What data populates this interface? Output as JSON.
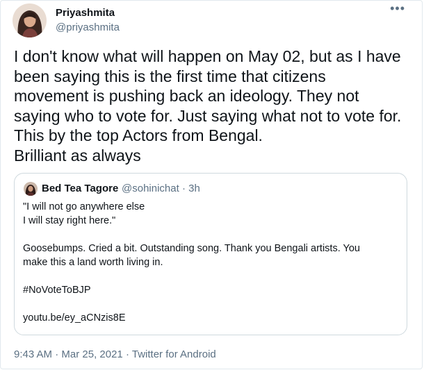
{
  "tweet": {
    "author": {
      "name": "Priyashmita",
      "handle": "@priyashmita",
      "avatar": "user-avatar-photo"
    },
    "more_icon": "more-horizontal-icon",
    "text": "I don't know what will happen on May 02, but as I have\nbeen saying this is the first time that citizens\nmovement is pushing back an ideology. They not\nsaying who to vote for. Just saying what not to vote for.\nThis by the top Actors from Bengal.\nBrilliant as always",
    "quoted": {
      "name": "Bed Tea Tagore",
      "meta": "@sohinichat · 3h",
      "avatar": "user-avatar-photo",
      "text": "\"I will not go anywhere else\nI will stay right here.\"\n\nGoosebumps. Cried a bit. Outstanding song. Thank you Bengali artists. You\nmake this a land worth living in.\n\n#NoVoteToBJP\n\nyoutu.be/ey_aCNzis8E"
    },
    "time": "9:43 AM",
    "date": "Mar 25, 2021",
    "source": "Twitter for Android",
    "separator": "·"
  }
}
